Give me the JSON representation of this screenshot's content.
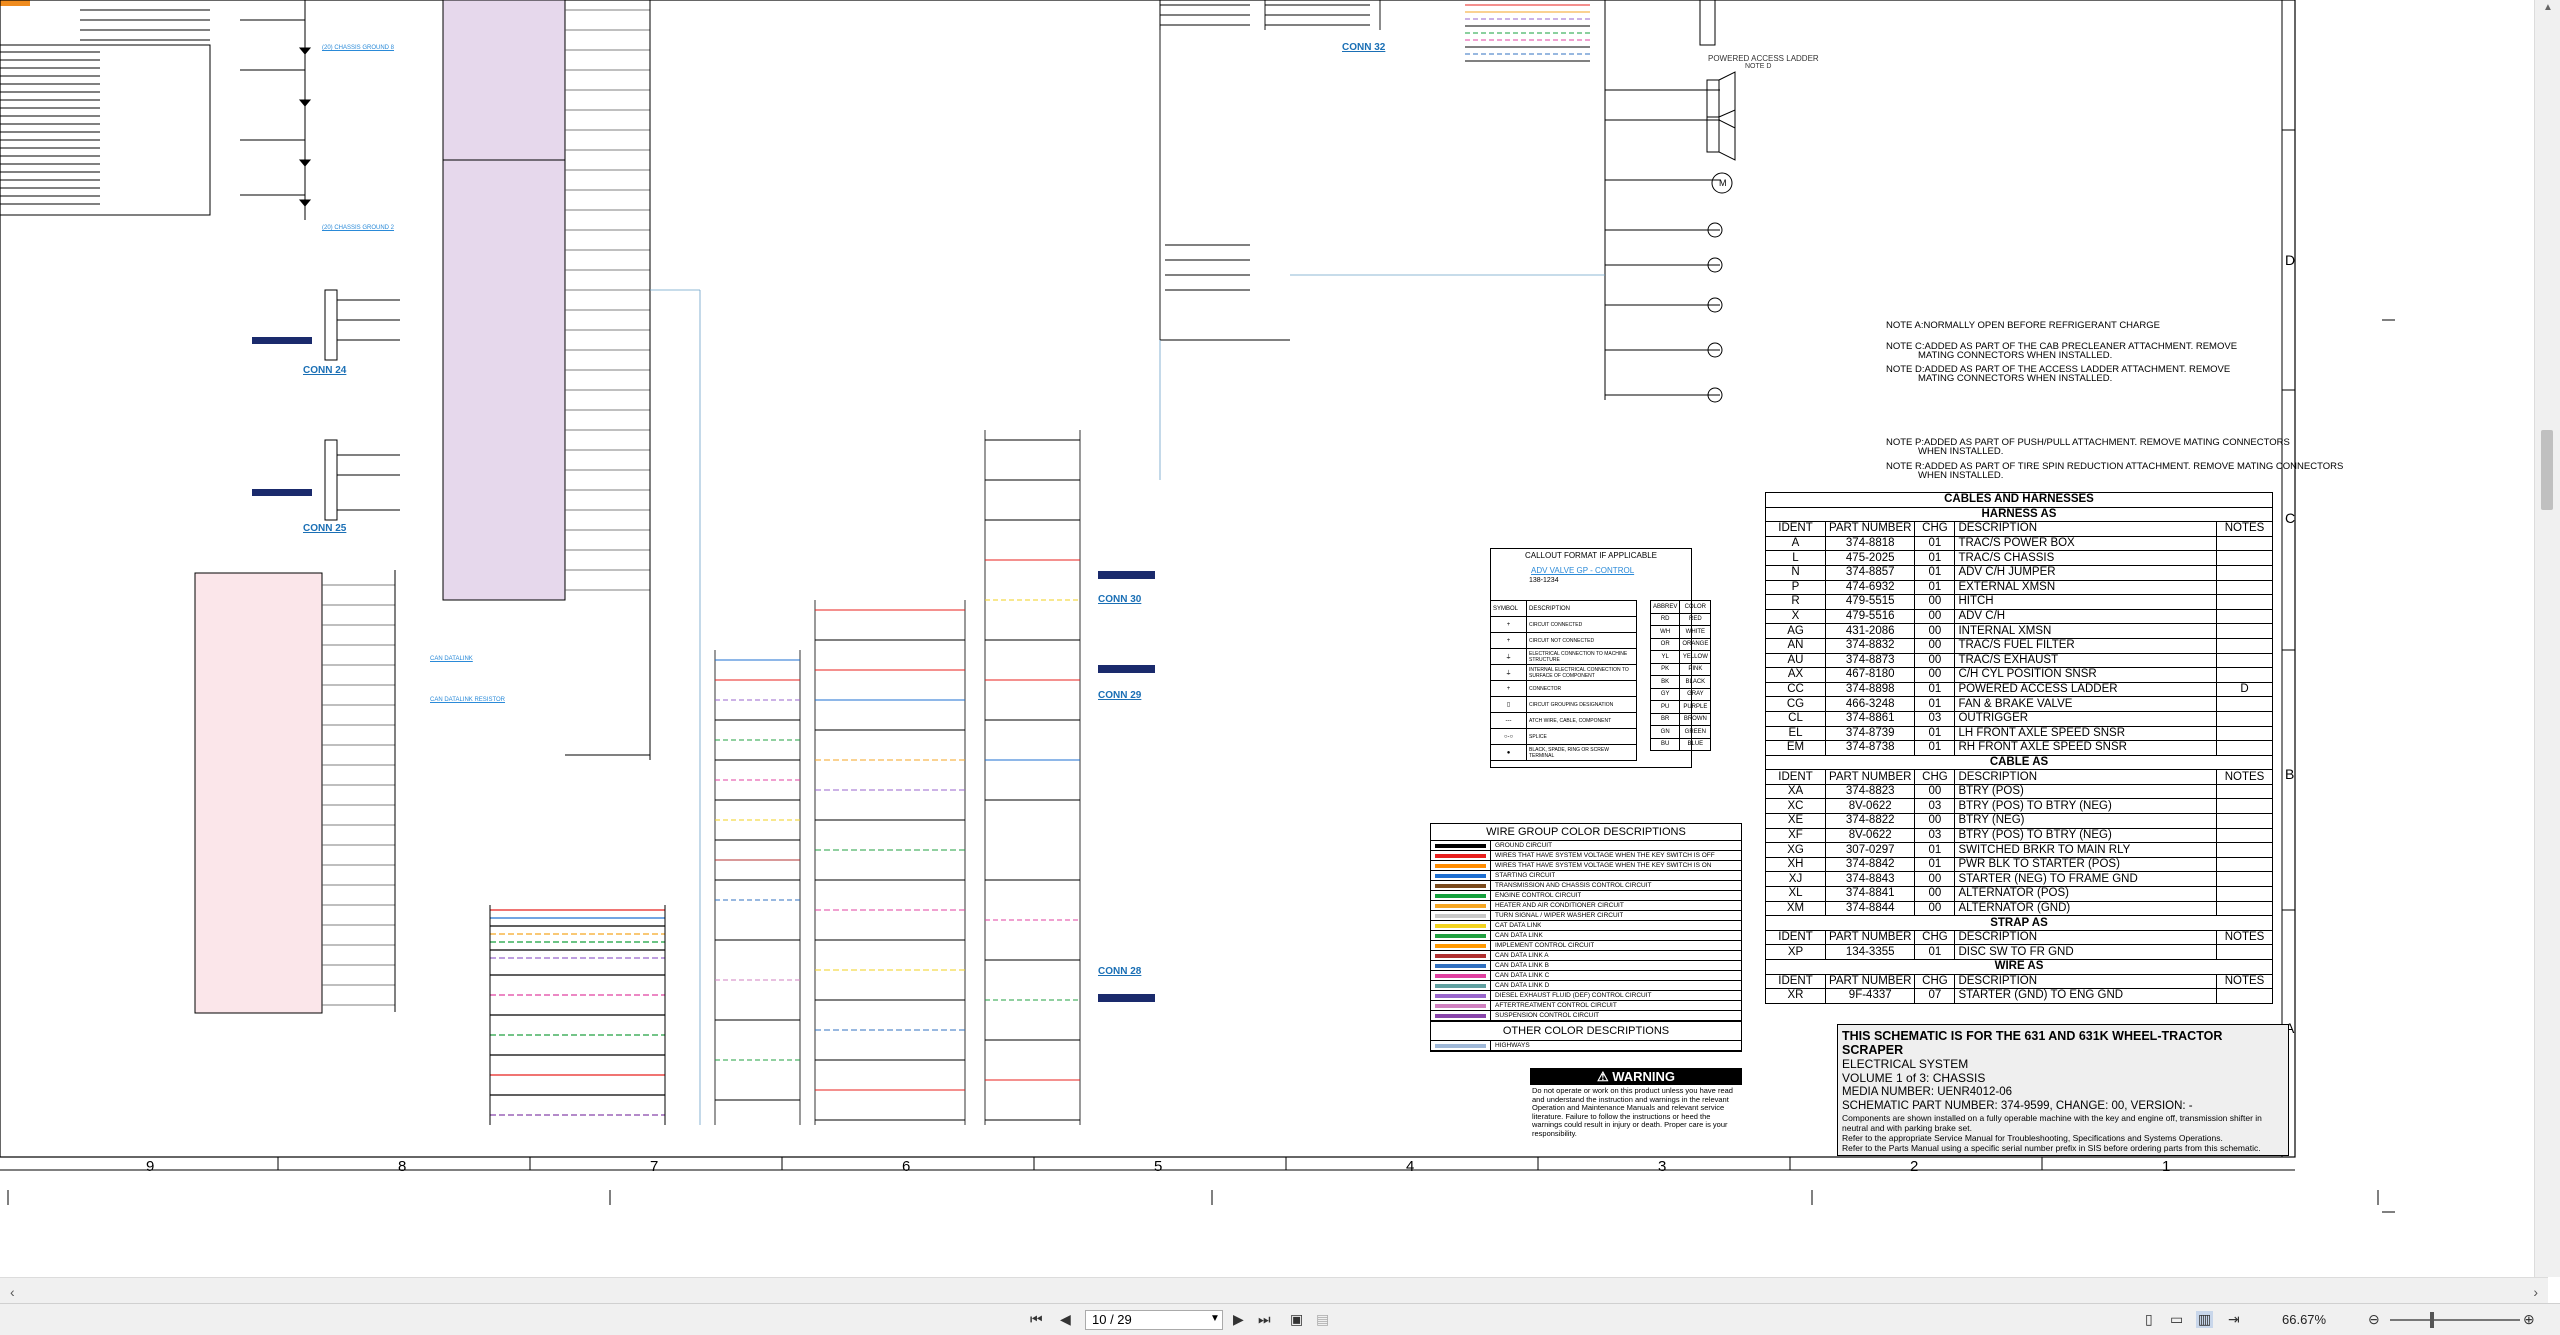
{
  "viewer": {
    "page_current": "10 / 29",
    "zoom": "66.67%",
    "colors": {
      "toolbar_bg": "#f0f0f0",
      "accent": "#f08c1e"
    }
  },
  "sheet": {
    "zone_numbers": [
      "9",
      "8",
      "7",
      "6",
      "5",
      "4",
      "3",
      "2",
      "1"
    ],
    "zone_letters": [
      "D",
      "C",
      "B",
      "A"
    ],
    "connectors": [
      "CONN 24",
      "CONN 25",
      "CONN 30",
      "CONN 29",
      "CONN 28",
      "CONN 32"
    ],
    "powered_access_ladder": "POWERED ACCESS LADDER",
    "note_d_small": "NOTE D",
    "notes": [
      "NOTE A:NORMALLY OPEN BEFORE REFRIGERANT CHARGE",
      "NOTE C:ADDED AS PART OF THE CAB PRECLEANER ATTACHMENT.  REMOVE",
      "MATING CONNECTORS WHEN INSTALLED.",
      "NOTE D:ADDED AS PART OF THE ACCESS LADDER ATTACHMENT.  REMOVE",
      "MATING CONNECTORS WHEN INSTALLED.",
      "NOTE P:ADDED AS PART OF PUSH/PULL ATTACHMENT.  REMOVE MATING CONNECTORS",
      "WHEN INSTALLED.",
      "NOTE R:ADDED AS PART OF TIRE SPIN REDUCTION ATTACHMENT.  REMOVE MATING CONNECTORS",
      "WHEN INSTALLED."
    ],
    "links": {
      "chassis_ground_8": "(20) CHASSIS GROUND 8",
      "chassis_ground_2": "(20) CHASSIS GROUND 2",
      "can_datalink": "CAN DATALINK",
      "can_datalink_resistor": "CAN DATALINK RESISTOR"
    }
  },
  "cables": {
    "title": "CABLES AND HARNESSES",
    "harness_title": "HARNESS AS",
    "cable_title": "CABLE AS",
    "strap_title": "STRAP AS",
    "wire_title": "WIRE AS",
    "headers": {
      "ident": "IDENT",
      "part": "PART NUMBER",
      "chg": "CHG",
      "desc": "DESCRIPTION",
      "notes": "NOTES"
    },
    "harness": [
      [
        "A",
        "374-8818",
        "01",
        "TRAC/S POWER BOX",
        ""
      ],
      [
        "L",
        "475-2025",
        "01",
        "TRAC/S CHASSIS",
        ""
      ],
      [
        "N",
        "374-8857",
        "01",
        "ADV C/H JUMPER",
        ""
      ],
      [
        "P",
        "474-6932",
        "01",
        "EXTERNAL XMSN",
        ""
      ],
      [
        "R",
        "479-5515",
        "00",
        "HITCH",
        ""
      ],
      [
        "X",
        "479-5516",
        "00",
        "ADV C/H",
        ""
      ],
      [
        "AG",
        "431-2086",
        "00",
        "INTERNAL XMSN",
        ""
      ],
      [
        "AN",
        "374-8832",
        "00",
        "TRAC/S FUEL FILTER",
        ""
      ],
      [
        "AU",
        "374-8873",
        "00",
        "TRAC/S EXHAUST",
        ""
      ],
      [
        "AX",
        "467-8180",
        "00",
        "C/H CYL POSITION SNSR",
        ""
      ],
      [
        "CC",
        "374-8898",
        "01",
        "POWERED ACCESS LADDER",
        "D"
      ],
      [
        "CG",
        "466-3248",
        "01",
        "FAN & BRAKE VALVE",
        ""
      ],
      [
        "CL",
        "374-8861",
        "03",
        "OUTRIGGER",
        ""
      ],
      [
        "EL",
        "374-8739",
        "01",
        "LH FRONT AXLE SPEED SNSR",
        ""
      ],
      [
        "EM",
        "374-8738",
        "01",
        "RH FRONT AXLE SPEED SNSR",
        ""
      ]
    ],
    "cable": [
      [
        "XA",
        "374-8823",
        "00",
        "BTRY (POS)",
        ""
      ],
      [
        "XC",
        "8V-0622",
        "03",
        "BTRY (POS) TO BTRY (NEG)",
        ""
      ],
      [
        "XE",
        "374-8822",
        "00",
        "BTRY (NEG)",
        ""
      ],
      [
        "XF",
        "8V-0622",
        "03",
        "BTRY (POS) TO BTRY (NEG)",
        ""
      ],
      [
        "XG",
        "307-0297",
        "01",
        "SWITCHED BRKR TO MAIN RLY",
        ""
      ],
      [
        "XH",
        "374-8842",
        "01",
        "PWR BLK TO STARTER (POS)",
        ""
      ],
      [
        "XJ",
        "374-8843",
        "00",
        "STARTER (NEG) TO FRAME GND",
        ""
      ],
      [
        "XL",
        "374-8841",
        "00",
        "ALTERNATOR (POS)",
        ""
      ],
      [
        "XM",
        "374-8844",
        "00",
        "ALTERNATOR (GND)",
        ""
      ]
    ],
    "strap": [
      [
        "XP",
        "134-3355",
        "01",
        "DISC SW TO FR GND",
        ""
      ]
    ],
    "wire": [
      [
        "XR",
        "9F-4337",
        "07",
        "STARTER (GND) TO ENG GND",
        ""
      ]
    ]
  },
  "callout": {
    "title": "CALLOUT FORMAT IF APPLICABLE",
    "example": "ADV VALVE GP - CONTROL",
    "example_num": "138-1234",
    "symbol_headers": [
      "SYMBOL",
      "DESCRIPTION"
    ],
    "symbols": [
      "CIRCUIT CONNECTED",
      "CIRCUIT NOT CONNECTED",
      "ELECTRICAL CONNECTION TO MACHINE STRUCTURE",
      "INTERNAL ELECTRICAL CONNECTION TO SURFACE OF COMPONENT",
      "CONNECTOR",
      "CIRCUIT GROUPING DESIGNATION",
      "ATCH WIRE, CABLE, COMPONENT",
      "SPLICE",
      "BLACK, SPADE, RING OR SCREW TERMINAL"
    ],
    "color_headers": [
      "ABBREV",
      "COLOR"
    ],
    "colors": [
      [
        "RD",
        "RED"
      ],
      [
        "WH",
        "WHITE"
      ],
      [
        "OR",
        "ORANGE"
      ],
      [
        "YL",
        "YELLOW"
      ],
      [
        "PK",
        "PINK"
      ],
      [
        "BK",
        "BLACK"
      ],
      [
        "GY",
        "GRAY"
      ],
      [
        "PU",
        "PURPLE"
      ],
      [
        "BR",
        "BROWN"
      ],
      [
        "GN",
        "GREEN"
      ],
      [
        "BU",
        "BLUE"
      ]
    ]
  },
  "wire_groups": {
    "title": "WIRE GROUP COLOR DESCRIPTIONS",
    "rows": [
      {
        "label": "GROUND CIRCUIT",
        "color": "#000000"
      },
      {
        "label": "WIRES THAT HAVE SYSTEM VOLTAGE WHEN THE KEY SWITCH IS OFF",
        "color": "#e8201e"
      },
      {
        "label": "WIRES THAT HAVE SYSTEM VOLTAGE WHEN THE KEY SWITCH IS ON",
        "color": "#ff8c00"
      },
      {
        "label": "STARTING CIRCUIT",
        "color": "#1d6fd1"
      },
      {
        "label": "TRANSMISSION AND CHASSIS CONTROL CIRCUIT",
        "color": "#7a4a1c"
      },
      {
        "label": "ENGINE CONTROL CIRCUIT",
        "color": "#14a03c"
      },
      {
        "label": "HEATER AND AIR CONDITIONER CIRCUIT",
        "color": "#f5a623"
      },
      {
        "label": "TURN SIGNAL / WIPER WASHER CIRCUIT",
        "color": "#c8c8c8"
      },
      {
        "label": "CAT DATA LINK",
        "color": "#f2d21e"
      },
      {
        "label": "CAN DATA LINK",
        "color": "#20a040"
      },
      {
        "label": "IMPLEMENT CONTROL CIRCUIT",
        "color": "#ff9900"
      },
      {
        "label": "CAN DATA LINK A",
        "color": "#b03030"
      },
      {
        "label": "CAN DATA LINK B",
        "color": "#3070c0"
      },
      {
        "label": "CAN DATA LINK C",
        "color": "#e040a0"
      },
      {
        "label": "CAN DATA LINK D",
        "color": "#60a0a0"
      },
      {
        "label": "DIESEL EXHAUST FLUID (DEF) CONTROL CIRCUIT",
        "color": "#9966cc"
      },
      {
        "label": "AFTERTREATMENT CONTROL CIRCUIT",
        "color": "#d080c0"
      },
      {
        "label": "SUSPENSION CONTROL CIRCUIT",
        "color": "#8844aa"
      }
    ],
    "other_title": "OTHER COLOR DESCRIPTIONS",
    "other_rows": [
      {
        "label": "HIGHWAYS",
        "color": "#9fb8d8"
      }
    ]
  },
  "warning": {
    "title": "WARNING",
    "text": "Do not operate or work on this product unless you have read and understand the instruction and warnings in the relevant Operation and Maintenance Manuals and relevant service literature. Failure to follow the instructions or heed the warnings could result in injury or death. Proper care is your responsibility."
  },
  "title_block": {
    "line1": "THIS SCHEMATIC IS FOR THE 631 AND 631K WHEEL-TRACTOR SCRAPER",
    "line2": "ELECTRICAL SYSTEM",
    "line3": "VOLUME 1 of 3: CHASSIS",
    "line4": "MEDIA NUMBER: UENR4012-06",
    "line5": "SCHEMATIC PART NUMBER: 374-9599, CHANGE: 00, VERSION: -",
    "line6": "Components are shown installed on a fully operable machine with the key and engine off, transmission shifter in neutral and with parking brake set.",
    "line7": "Refer to the appropriate Service Manual for Troubleshooting, Specifications and Systems Operations.",
    "line8": "Refer to the Parts Manual using a specific serial number prefix in SIS before ordering parts from this schematic."
  }
}
